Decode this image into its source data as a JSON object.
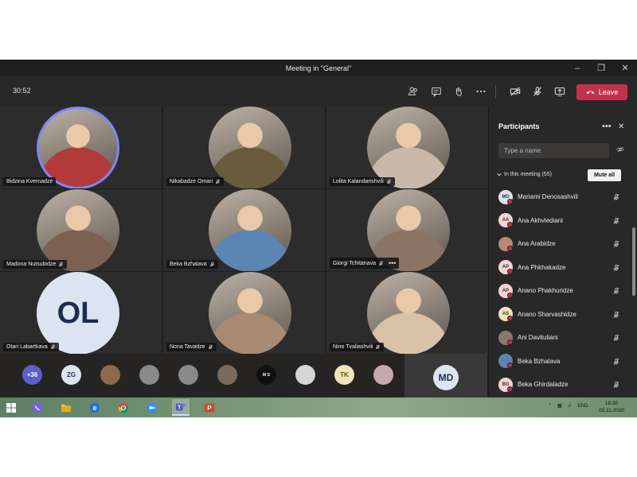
{
  "window": {
    "title": "Meeting in \"General\""
  },
  "toolbar": {
    "timer": "30:52",
    "leave_label": "Leave"
  },
  "tiles": [
    {
      "name": "Bidzina Kvernadze",
      "muted": false,
      "speaking": true,
      "bg": "#b33a3a"
    },
    {
      "name": "Nikabadze Omari",
      "muted": true,
      "speaking": false,
      "bg": "#6a5a3e"
    },
    {
      "name": "Lolita Kalandarishvili",
      "muted": true,
      "speaking": false,
      "bg": "#c9b7a8"
    },
    {
      "name": "Madona Nutsubidze",
      "muted": true,
      "speaking": false,
      "bg": "#7a6152"
    },
    {
      "name": "Beka Bzhalava",
      "muted": true,
      "speaking": false,
      "bg": "#5b86b3"
    },
    {
      "name": "Giorgi Tchitanava",
      "muted": true,
      "speaking": false,
      "bg": "#8a7466"
    },
    {
      "name": "Otari Labartkava",
      "muted": true,
      "speaking": false,
      "initials": "OL"
    },
    {
      "name": "Nona Tavadze",
      "muted": true,
      "speaking": false,
      "bg": "#a98a72"
    },
    {
      "name": "Nino Tvaliashvili",
      "muted": true,
      "speaking": false,
      "bg": "#d9c3a8"
    }
  ],
  "strip": {
    "overflow_label": "+36",
    "avatars": [
      {
        "label": "ZG",
        "bg": "#dce4f2",
        "fg": "#1b2e4f"
      },
      {
        "label": "",
        "bg": "#8c6b4a"
      },
      {
        "label": "",
        "bg": "#8a8a8a"
      },
      {
        "label": "",
        "bg": "#8a8a8a"
      },
      {
        "label": "",
        "bg": "#7a6a5a"
      },
      {
        "label": "M S",
        "bg": "#111111",
        "fg": "#ffffff"
      },
      {
        "label": "",
        "bg": "#d5d5d5"
      },
      {
        "label": "TK",
        "bg": "#f3e3b8",
        "fg": "#6b4d12"
      },
      {
        "label": "",
        "bg": "#c8a8b0"
      }
    ],
    "self_initials": "MD"
  },
  "panel": {
    "title": "Participants",
    "search_placeholder": "Type a name",
    "section_label": "In this meeting (55)",
    "mute_all_label": "Mute all",
    "participants": [
      {
        "initials": "MD",
        "name": "Mariami Denosashvili",
        "bg": "#dce4f2"
      },
      {
        "initials": "AA",
        "name": "Ana Akhvlediani",
        "bg": "#f6d3d6"
      },
      {
        "initials": "",
        "name": "Ana Arabidze",
        "bg": "#b78a73"
      },
      {
        "initials": "AP",
        "name": "Ana Phkhakadze",
        "bg": "#f6d3d6"
      },
      {
        "initials": "AP",
        "name": "Anano Phakhuridze",
        "bg": "#f6d3d6"
      },
      {
        "initials": "AS",
        "name": "Anano Sharvashidze",
        "bg": "#f3e3b8"
      },
      {
        "initials": "",
        "name": "Ani Davituliani",
        "bg": "#8a7a6a"
      },
      {
        "initials": "",
        "name": "Beka Bzhalava",
        "bg": "#5b86b3"
      },
      {
        "initials": "BG",
        "name": "Beka Ghirdaladze",
        "bg": "#f6d3d6"
      }
    ]
  },
  "taskbar": {
    "tray_lang": "ENG",
    "time": "18:30",
    "date": "05.11.2020"
  },
  "colors": {
    "accent": "#7f85f5",
    "leave": "#c4314b",
    "panel_bg": "#292828",
    "stage_bg": "#201f1f"
  }
}
